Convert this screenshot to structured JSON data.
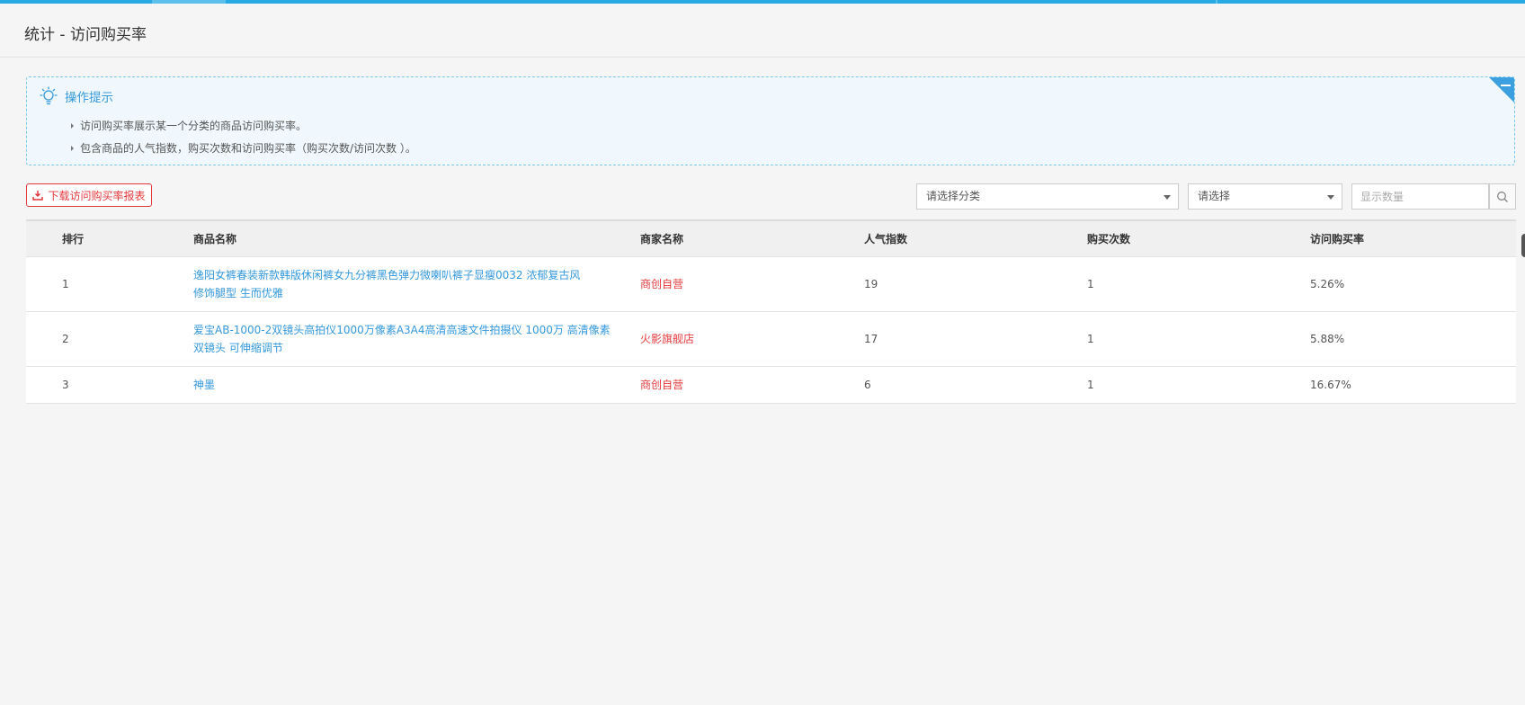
{
  "page": {
    "title": "统计 - 访问购买率"
  },
  "tips": {
    "title": "操作提示",
    "items": [
      "访问购买率展示某一个分类的商品访问购买率。",
      "包含商品的人气指数，购买次数和访问购买率（购买次数/访问次数 ）。"
    ]
  },
  "toolbar": {
    "download_label": "下载访问购买率报表",
    "category_select": "请选择分类",
    "sub_select": "请选择",
    "count_placeholder": "显示数量"
  },
  "table": {
    "headers": {
      "rank": "排行",
      "goods": "商品名称",
      "shop": "商家名称",
      "popularity": "人气指数",
      "purchases": "购买次数",
      "rate": "访问购买率"
    },
    "rows": [
      {
        "rank": "1",
        "goods_line1": "逸阳女裤春装新款韩版休闲裤女九分裤黑色弹力微喇叭裤子显瘦0032 浓郁复古风",
        "goods_line2": "修饰腿型 生而优雅",
        "shop": "商创自营",
        "popularity": "19",
        "purchases": "1",
        "rate": "5.26%"
      },
      {
        "rank": "2",
        "goods_line1": "爱宝AB-1000-2双镜头高拍仪1000万像素A3A4高清高速文件拍摄仪 1000万 高清像素",
        "goods_line2": "双镜头 可伸缩调节",
        "shop": "火影旗舰店",
        "popularity": "17",
        "purchases": "1",
        "rate": "5.88%"
      },
      {
        "rank": "3",
        "goods_line1": "神墨",
        "goods_line2": "",
        "shop": "商创自营",
        "popularity": "6",
        "purchases": "1",
        "rate": "16.67%"
      }
    ]
  },
  "colors": {
    "accent": "#27a9e3",
    "link": "#3498db",
    "shop": "#e4393c",
    "tips_bg": "#f0f8fd"
  }
}
